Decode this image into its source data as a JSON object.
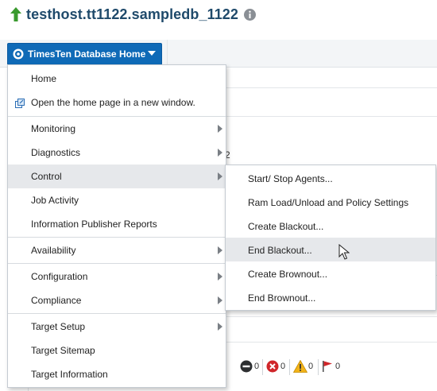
{
  "header": {
    "title": "testhost.tt1122.sampledb_1122"
  },
  "home_button": {
    "label": "TimesTen Database Home"
  },
  "background": {
    "partial_text": "2"
  },
  "main_menu": {
    "items": [
      {
        "label": "Home"
      },
      {
        "label": "Open the home page in a new window."
      },
      {
        "label": "Monitoring"
      },
      {
        "label": "Diagnostics"
      },
      {
        "label": "Control"
      },
      {
        "label": "Job Activity"
      },
      {
        "label": "Information Publisher Reports"
      },
      {
        "label": "Availability"
      },
      {
        "label": "Configuration"
      },
      {
        "label": "Compliance"
      },
      {
        "label": "Target Setup"
      },
      {
        "label": "Target Sitemap"
      },
      {
        "label": "Target Information"
      }
    ]
  },
  "control_submenu": {
    "items": [
      {
        "label": "Start/ Stop Agents..."
      },
      {
        "label": "Ram Load/Unload and Policy Settings"
      },
      {
        "label": "Create Blackout..."
      },
      {
        "label": "End Blackout..."
      },
      {
        "label": "Create Brownout..."
      },
      {
        "label": "End Brownout..."
      }
    ]
  },
  "incident_counts": {
    "down": "0",
    "critical": "0",
    "warning": "0",
    "flag": "0"
  },
  "colors": {
    "title": "#1f4a6b",
    "button_bg": "#0f6ab7",
    "up_arrow": "#3a9a2e",
    "critical": "#d0262a",
    "warning": "#f2b318",
    "flag": "#d0262a"
  }
}
